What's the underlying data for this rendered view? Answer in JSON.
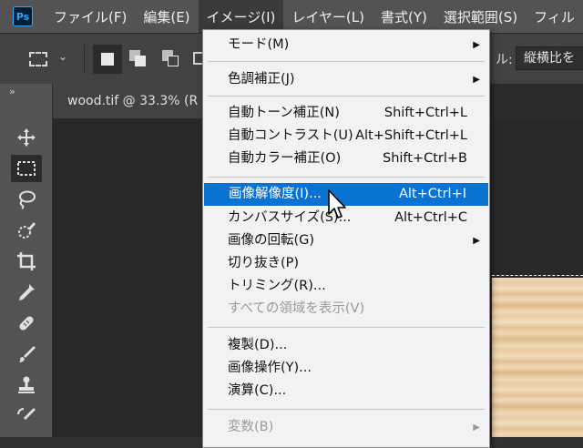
{
  "app": {
    "logo_text": "Ps"
  },
  "menubar": {
    "items": [
      {
        "label": "ファイル(F)"
      },
      {
        "label": "編集(E)"
      },
      {
        "label": "イメージ(I)"
      },
      {
        "label": "レイヤー(L)"
      },
      {
        "label": "書式(Y)"
      },
      {
        "label": "選択範囲(S)"
      },
      {
        "label": "フィル"
      }
    ]
  },
  "options_bar": {
    "style_label": "ル:",
    "style_value": "縦横比を"
  },
  "document": {
    "tab_title": "wood.tif @ 33.3% (R"
  },
  "image_menu": {
    "items": [
      {
        "label": "モード(M)",
        "shortcut": "",
        "submenu": true,
        "disabled": false
      },
      {
        "label": "色調補正(J)",
        "shortcut": "",
        "submenu": true,
        "disabled": false
      },
      {
        "label": "自動トーン補正(N)",
        "shortcut": "Shift+Ctrl+L",
        "submenu": false,
        "disabled": false
      },
      {
        "label": "自動コントラスト(U)",
        "shortcut": "Alt+Shift+Ctrl+L",
        "submenu": false,
        "disabled": false
      },
      {
        "label": "自動カラー補正(O)",
        "shortcut": "Shift+Ctrl+B",
        "submenu": false,
        "disabled": false
      },
      {
        "label": "画像解像度(I)...",
        "shortcut": "Alt+Ctrl+I",
        "submenu": false,
        "disabled": false,
        "highlighted": true
      },
      {
        "label": "カンバスサイズ(S)...",
        "shortcut": "Alt+Ctrl+C",
        "submenu": false,
        "disabled": false
      },
      {
        "label": "画像の回転(G)",
        "shortcut": "",
        "submenu": true,
        "disabled": false
      },
      {
        "label": "切り抜き(P)",
        "shortcut": "",
        "submenu": false,
        "disabled": false
      },
      {
        "label": "トリミング(R)...",
        "shortcut": "",
        "submenu": false,
        "disabled": false
      },
      {
        "label": "すべての領域を表示(V)",
        "shortcut": "",
        "submenu": false,
        "disabled": true
      },
      {
        "label": "複製(D)...",
        "shortcut": "",
        "submenu": false,
        "disabled": false
      },
      {
        "label": "画像操作(Y)...",
        "shortcut": "",
        "submenu": false,
        "disabled": false
      },
      {
        "label": "演算(C)...",
        "shortcut": "",
        "submenu": false,
        "disabled": false
      },
      {
        "label": "変数(B)",
        "shortcut": "",
        "submenu": true,
        "disabled": true
      }
    ]
  },
  "colors": {
    "menubar_bg": "#535353",
    "menu_highlight": "#0a73d2",
    "ps_blue": "#31a8ff"
  }
}
